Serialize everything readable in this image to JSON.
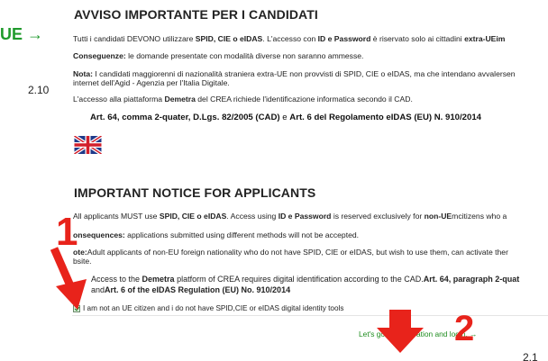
{
  "left_fragment": {
    "green_text": "UE →",
    "version": "2.10"
  },
  "italian": {
    "title": "AVVISO IMPORTANTE PER I CANDIDATI",
    "line1": {
      "a": "Tutti i candidati DEVONO utilizzare ",
      "b": "SPID, CIE o eIDAS",
      "c": ". L'accesso con ",
      "d": "ID e Password",
      "e": " è riservato solo ai cittadini ",
      "f": "extra-UEim"
    },
    "line2": {
      "a": "Conseguenze:",
      "b": " le domande presentate con modalità diverse non saranno ammesse."
    },
    "line3": {
      "a": "Nota:",
      "b": " I candidati maggiorenni di nazionalità straniera extra-UE non provvisti di SPID, CIE o eIDAS, ma che intendano avvalersen"
    },
    "line4": "internet dell'Agid - Agenzia per l'Italia Digitale.",
    "line5": {
      "a": "L'accesso alla piattaforma ",
      "b": "Demetra",
      "c": " del CREA richiede l'identificazione informatica secondo il CAD."
    },
    "article": {
      "a": "Art. 64, comma 2-quater, D.Lgs. 82/2005 (CAD)",
      "b": " e ",
      "c": "Art. 6 del Regolamento eIDAS (EU) N. 910/2014"
    }
  },
  "flag_icon": "uk-flag-icon",
  "english": {
    "title": "IMPORTANT NOTICE FOR APPLICANTS",
    "line1": {
      "a": "All applicants MUST use ",
      "b": "SPID, CIE o eIDAS",
      "c": ". Access using ",
      "d": "ID e Password",
      "e": " is reserved exclusively for ",
      "f": "non-UE",
      "g": "mcitizens who a"
    },
    "line2": {
      "a": "onsequences:",
      "b": " applications submitted using different methods will not be accepted."
    },
    "line3": {
      "a": "ote:",
      "b": "Adult applicants of non-EU foreign nationality who do not have SPID, CIE or eIDAS, but wish to use them, can activate ther"
    },
    "line4": "bsite.",
    "line5": {
      "a": "Access to the ",
      "b": "Demetra",
      "c": " platform of CREA requires digital identification according to the CAD.",
      "d": "Art. 64, paragraph 2-quat"
    },
    "line6": {
      "a": "and",
      "b": "Art. 6 of the eIDAS Regulation (EU) No. 910/2014"
    }
  },
  "consent": {
    "checked": true,
    "label": "I am not an UE citizen and i do not have SPID,CIE or eIDAS digital identity tools"
  },
  "go_link": "Let's go to registration and login. →",
  "bottom_version": "2.1",
  "annotations": {
    "step1": "1",
    "step2": "2",
    "color": "#e8231b"
  }
}
